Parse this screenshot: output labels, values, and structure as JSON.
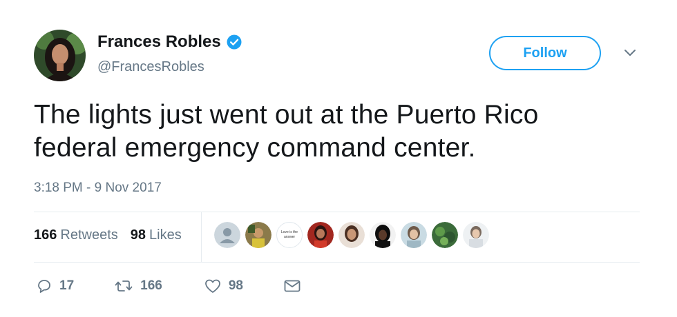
{
  "user": {
    "name": "Frances Robles",
    "handle": "@FrancesRobles",
    "verified": true
  },
  "follow_label": "Follow",
  "tweet": {
    "line1": "The lights just went out at the Puerto Rico",
    "line2": "federal emergency command center.",
    "timestamp": "3:18 PM - 9 Nov 2017"
  },
  "stats": {
    "retweets_count": "166",
    "retweets_label": "Retweets",
    "likes_count": "98",
    "likes_label": "Likes"
  },
  "likers": [
    {
      "icon": "default-avatar"
    },
    {
      "icon": "liker-avatar-2"
    },
    {
      "icon": "liker-avatar-3",
      "text1": "Love is the",
      "text2": "answer"
    },
    {
      "icon": "liker-avatar-4"
    },
    {
      "icon": "liker-avatar-5"
    },
    {
      "icon": "liker-avatar-6"
    },
    {
      "icon": "liker-avatar-7"
    },
    {
      "icon": "liker-avatar-8"
    },
    {
      "icon": "liker-avatar-9"
    }
  ],
  "actions": {
    "reply_count": "17",
    "retweet_count": "166",
    "like_count": "98"
  },
  "colors": {
    "accent": "#1da1f2",
    "text": "#14171a",
    "muted": "#657786",
    "divider": "#e6ecf0"
  }
}
